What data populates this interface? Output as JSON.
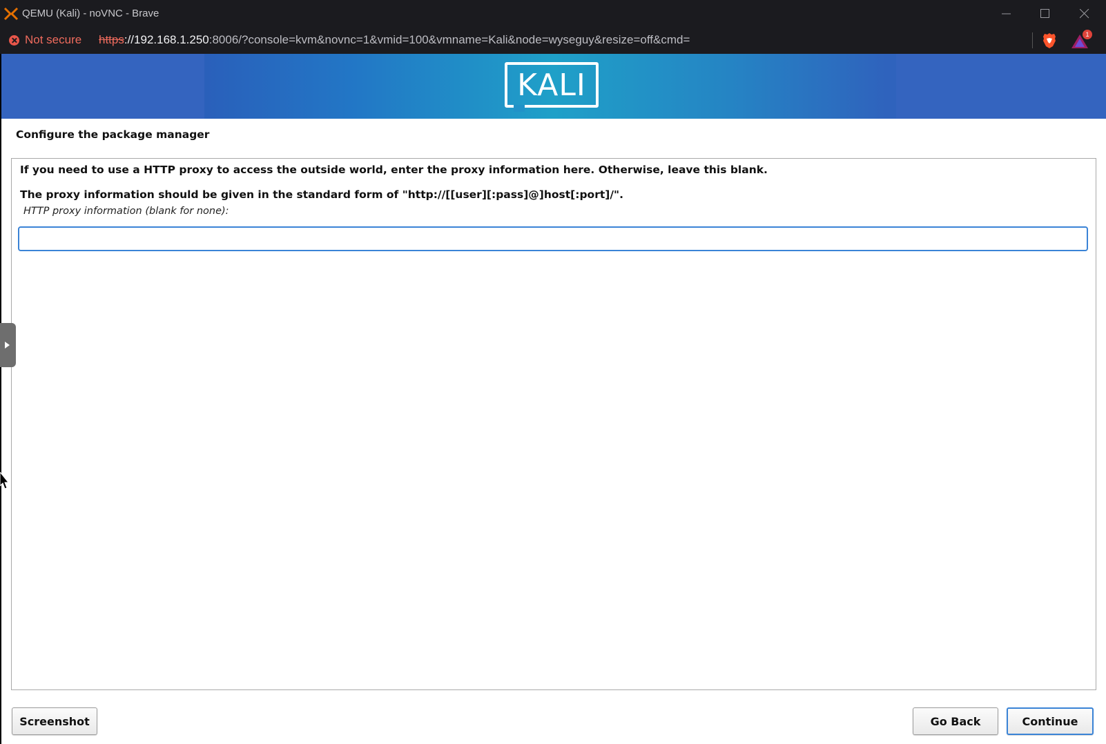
{
  "window": {
    "title": "QEMU (Kali) - noVNC - Brave",
    "controls": [
      "minimize",
      "maximize",
      "close"
    ]
  },
  "addressbar": {
    "security_label": "Not secure",
    "url_scheme": "https",
    "url_host": "://192.168.1.250",
    "url_rest": ":8006/?console=kvm&novnc=1&vmid=100&vmname=Kali&node=wyseguy&resize=off&cmd=",
    "rewards_badge": "1"
  },
  "installer": {
    "logo_text": "KALI",
    "step_title": "Configure the package manager",
    "description_1": "If you need to use a HTTP proxy to access the outside world, enter the proxy information here. Otherwise, leave this blank.",
    "description_2": "The proxy information should be given in the standard form of \"http://[[user][:pass]@]host[:port]/\".",
    "field_label": "HTTP proxy information (blank for none):",
    "field_value": "",
    "buttons": {
      "screenshot": "Screenshot",
      "go_back": "Go Back",
      "continue": "Continue"
    }
  },
  "colors": {
    "accent": "#3a83d6",
    "insecure": "#ef6b5d",
    "banner": "#2192c8"
  }
}
